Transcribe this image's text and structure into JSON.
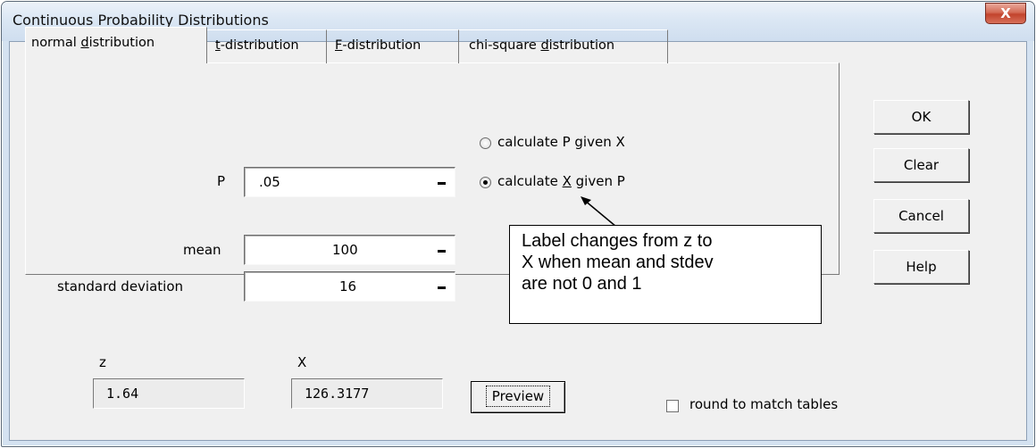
{
  "window": {
    "title": "Continuous Probability Distributions",
    "close_glyph": "X"
  },
  "tabs": [
    {
      "pre": "normal ",
      "key": "d",
      "post": "istribution",
      "selected": true
    },
    {
      "pre": "",
      "key": "t",
      "post": "-distribution",
      "selected": false
    },
    {
      "pre": "",
      "key": "F",
      "post": "-distribution",
      "selected": false
    },
    {
      "pre": "chi-square ",
      "key": "d",
      "post": "istribution",
      "selected": false
    }
  ],
  "mode": {
    "option_p": "calculate P given X",
    "option_x_pre": "calculate ",
    "option_x_key": "X",
    "option_x_post": " given P",
    "selected": "calculate X given P"
  },
  "inputs": {
    "p_label": "P",
    "p_value": ".05",
    "mean_label": "mean",
    "mean_value": "100",
    "sd_label": "standard deviation",
    "sd_value": "16"
  },
  "results": {
    "z_label": "z",
    "z_value": "1.64",
    "x_label": "X",
    "x_value": "126.3177"
  },
  "buttons": {
    "ok": "OK",
    "clear": "Clear",
    "cancel": "Cancel",
    "help": "Help",
    "preview": "Preview"
  },
  "round_option": {
    "label": "round to match tables",
    "checked": false
  },
  "callout": {
    "lines": [
      "Label changes from z to",
      "X when mean and stdev",
      "are not 0 and 1"
    ]
  }
}
